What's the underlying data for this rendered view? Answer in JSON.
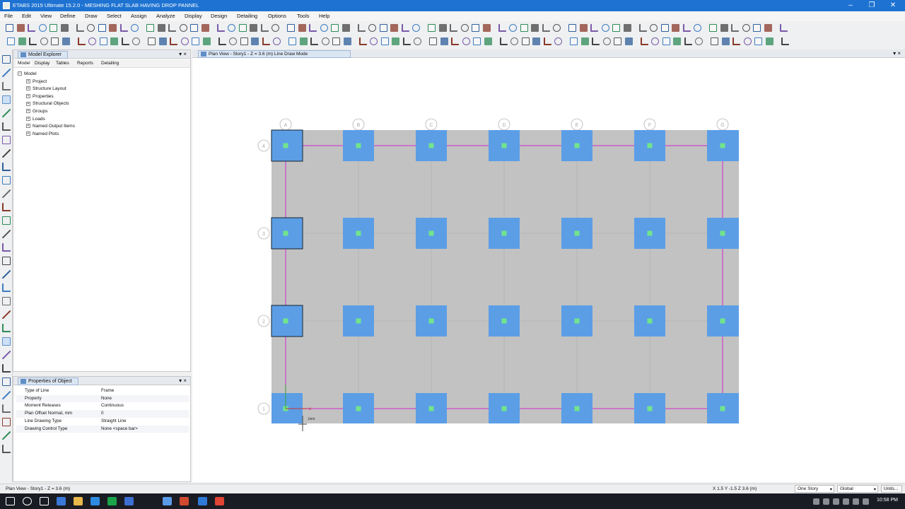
{
  "window": {
    "title": "ETABS 2015 Ultimate 15.2.0 - MESHING FLAT SLAB HAVING DROP PANNEL"
  },
  "menu": [
    "File",
    "Edit",
    "View",
    "Define",
    "Draw",
    "Select",
    "Assign",
    "Analyze",
    "Display",
    "Design",
    "Detailing",
    "Options",
    "Tools",
    "Help"
  ],
  "model_explorer": {
    "title": "Model Explorer",
    "tabs": [
      "Model",
      "Display",
      "Tables",
      "Reports",
      "Detailing"
    ],
    "root": "Model",
    "children": [
      "Project",
      "Structure Layout",
      "Properties",
      "Structural Objects",
      "Groups",
      "Loads",
      "Named Output Items",
      "Named Plots"
    ]
  },
  "properties_panel": {
    "title": "Properties of Object",
    "rows": [
      {
        "key": "Type of Line",
        "value": "Frame"
      },
      {
        "key": "Property",
        "value": "None"
      },
      {
        "key": "Moment Releases",
        "value": "Continuous"
      },
      {
        "key": "Plan Offset Normal, mm",
        "value": "0"
      },
      {
        "key": "Line Drawing Type",
        "value": "Straight Line"
      },
      {
        "key": "Drawing Control Type",
        "value": "None <space bar>"
      }
    ]
  },
  "view": {
    "tab_title": "Plan View - Story1 - Z = 3.6 (m)  Line Draw Mode",
    "grid_columns": [
      "A",
      "B",
      "C",
      "D",
      "E",
      "F",
      "G"
    ],
    "grid_rows": [
      "4",
      "3",
      "2",
      "1"
    ],
    "cursor_label": "Joint"
  },
  "status": {
    "left": "Plan View - Story1 - Z = 3.6 (m)",
    "coords": "X 1.5  Y -1.5  Z 3.6 (m)",
    "story_select": "One Story",
    "coord_system": "Global",
    "units": "Units..."
  },
  "taskbar": {
    "time": "10:58 PM"
  },
  "colors": {
    "titlebar": "#1e73d2",
    "slab": "#c2c2c2",
    "drop_panel": "#5b9ee6",
    "joint": "#72e48c",
    "beam_line": "#cc44cc"
  }
}
